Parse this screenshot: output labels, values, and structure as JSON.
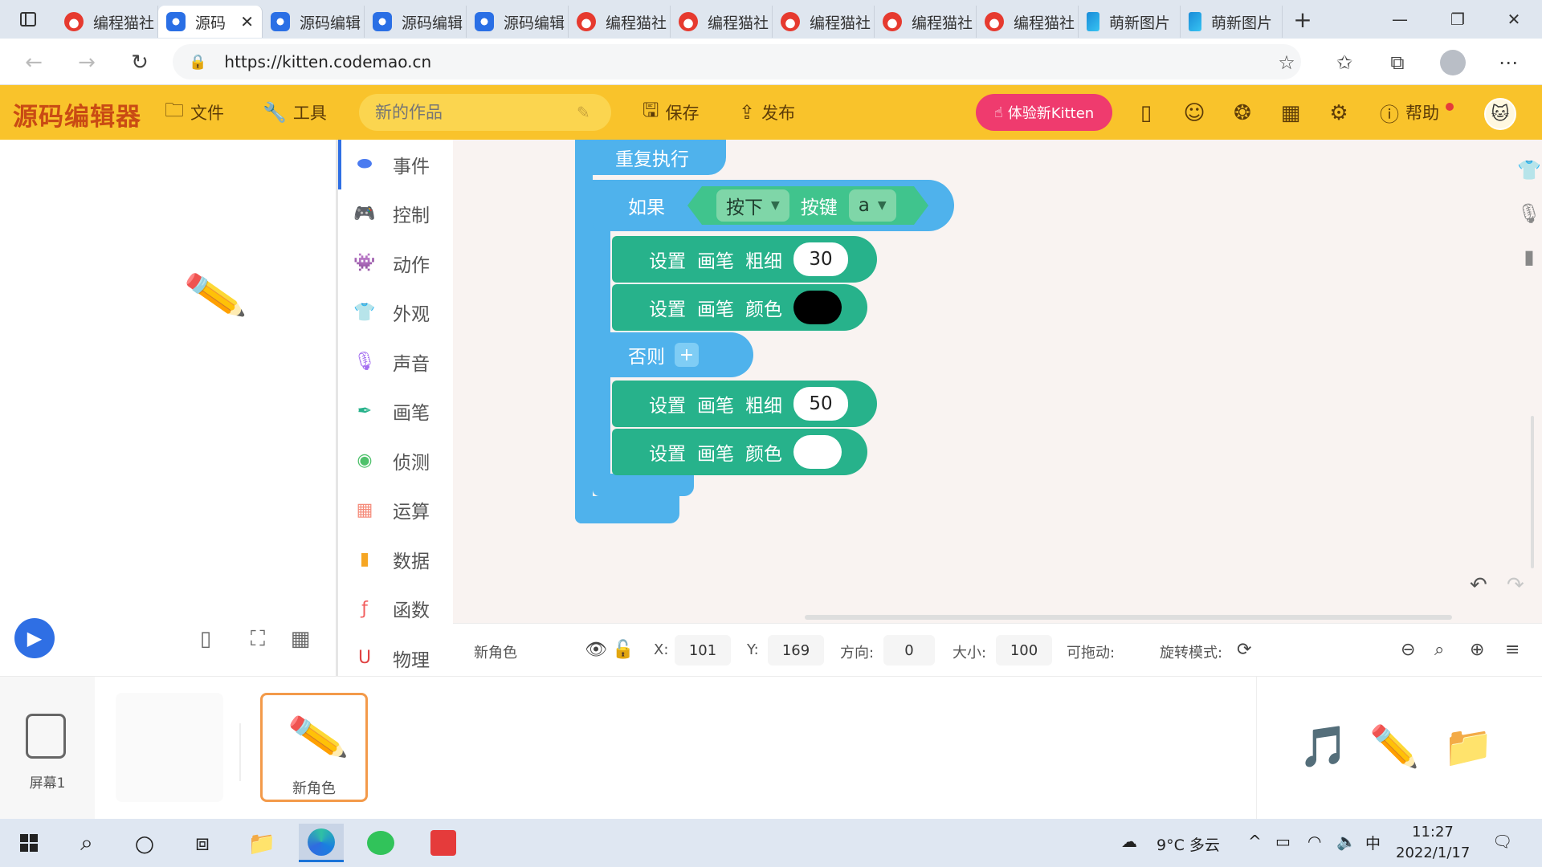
{
  "browser": {
    "tabs": [
      {
        "title": "编程猫社",
        "favicon": "codemao-cat-icon",
        "active": false
      },
      {
        "title": "源码",
        "favicon": "kitten-icon",
        "active": true
      },
      {
        "title": "源码编辑",
        "favicon": "kitten-icon",
        "active": false
      },
      {
        "title": "源码编辑",
        "favicon": "kitten-icon",
        "active": false
      },
      {
        "title": "源码编辑",
        "favicon": "kitten-icon",
        "active": false
      },
      {
        "title": "编程猫社",
        "favicon": "codemao-cat-icon",
        "active": false
      },
      {
        "title": "编程猫社",
        "favicon": "codemao-cat-icon",
        "active": false
      },
      {
        "title": "编程猫社",
        "favicon": "codemao-cat-icon",
        "active": false
      },
      {
        "title": "编程猫社",
        "favicon": "codemao-cat-icon",
        "active": false
      },
      {
        "title": "编程猫社",
        "favicon": "codemao-cat-icon",
        "active": false
      },
      {
        "title": "萌新图片",
        "favicon": "bing-icon",
        "active": false
      },
      {
        "title": "萌新图片",
        "favicon": "bing-icon",
        "active": false
      }
    ],
    "url": "https://kitten.codemao.cn"
  },
  "toolbar": {
    "logo": "源码编辑器",
    "file_label": "文件",
    "tools_label": "工具",
    "title_placeholder": "新的作品",
    "save_label": "保存",
    "publish_label": "发布",
    "try_kitten_label": "体验新Kitten",
    "help_label": "帮助",
    "accent_color": "#f9c32b"
  },
  "categories": [
    {
      "label": "事件",
      "icon": "toggle-icon",
      "color": "#4a7bf0"
    },
    {
      "label": "控制",
      "icon": "gamepad-icon",
      "color": "#4fb2ec"
    },
    {
      "label": "动作",
      "icon": "ghost-icon",
      "color": "#ef4f66"
    },
    {
      "label": "外观",
      "icon": "shirt-icon",
      "color": "#e45fd0"
    },
    {
      "label": "声音",
      "icon": "microphone-icon",
      "color": "#a46ff0"
    },
    {
      "label": "画笔",
      "icon": "pen-icon",
      "color": "#27b28b"
    },
    {
      "label": "侦测",
      "icon": "radar-icon",
      "color": "#4ec16b"
    },
    {
      "label": "运算",
      "icon": "calculator-icon",
      "color": "#f58c7b"
    },
    {
      "label": "数据",
      "icon": "bar-chart-icon",
      "color": "#f6a623"
    },
    {
      "label": "函数",
      "icon": "function-icon",
      "color": "#f25c5c"
    },
    {
      "label": "物理",
      "icon": "magnet-icon",
      "color": "#e04343"
    }
  ],
  "blocks": {
    "repeat_label": "重复执行",
    "if_label": "如果",
    "cond_mode": "按下",
    "cond_key_label": "按键",
    "cond_key": "a",
    "then_1": {
      "word1": "设置",
      "word2": "画笔",
      "word3": "粗细",
      "value": "30"
    },
    "then_2": {
      "word1": "设置",
      "word2": "画笔",
      "word3": "颜色",
      "color": "#000000"
    },
    "else_label": "否则",
    "else_1": {
      "word1": "设置",
      "word2": "画笔",
      "word3": "粗细",
      "value": "50"
    },
    "else_2": {
      "word1": "设置",
      "word2": "画笔",
      "word3": "颜色",
      "color": "#ffffff"
    },
    "control_color": "#4fb2ec",
    "pen_color": "#27b28b",
    "sensing_color": "#40c48d"
  },
  "properties": {
    "name": "新角色",
    "x_label": "X:",
    "x": "101",
    "y_label": "Y:",
    "y": "169",
    "direction_label": "方向:",
    "direction": "0",
    "size_label": "大小:",
    "size": "100",
    "draggable_label": "可拖动:",
    "rotation_label": "旋转模式:"
  },
  "tray": {
    "screen_label": "屏幕1",
    "sprite_label": "新角色"
  },
  "taskbar": {
    "weather": "9°C 多云",
    "ime": "中",
    "time": "11:27",
    "date": "2022/1/17"
  }
}
